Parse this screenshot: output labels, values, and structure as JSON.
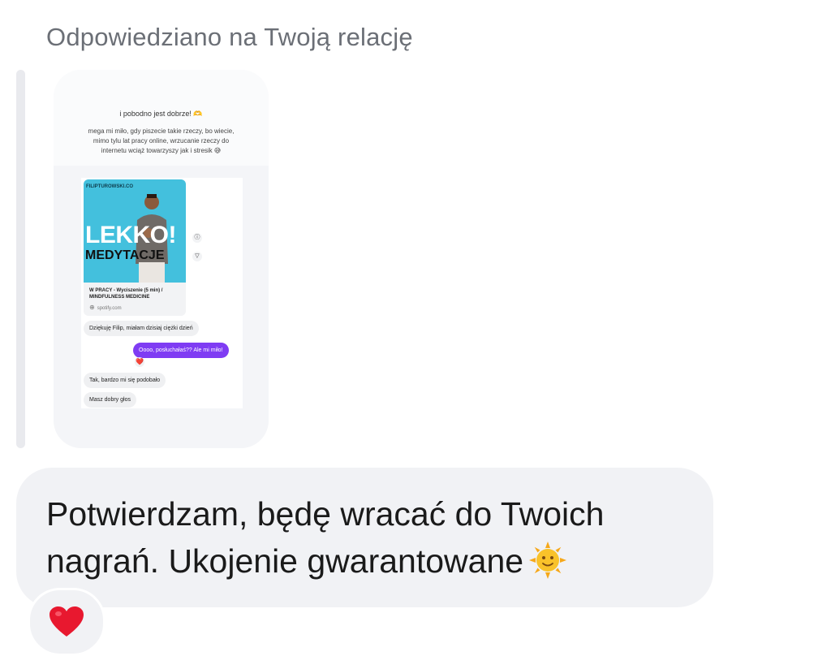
{
  "reply_header": "Odpowiedziano na Twoją relację",
  "story": {
    "heading": "i pobodno jest dobrze! 🫶",
    "body_lines": [
      "mega mi miło, gdy piszecie takie rzeczy, bo wiecie,",
      "mimo tylu lat pracy online, wrzucanie rzeczy do",
      "internetu wciąż towarzyszy jak i stresik 😅"
    ],
    "link_card": {
      "domain_badge": "FILIPTUROWSKI.CO",
      "thumb_title_1": "LEKKO!",
      "thumb_title_2": "MEDYTACJE",
      "title": "W PRACY - Wyciszenie (5 min) / MINDFULNESS MEDICINE",
      "source": "spotify.com"
    },
    "side_icons": [
      "ⓘ",
      "▽"
    ],
    "messages": [
      {
        "type": "received",
        "text": "Dziękuję Filip, miałam dzisiaj ciężki dzień"
      },
      {
        "type": "sent",
        "text": "Oooo, posłuchałaś?? Ale mi miło!"
      },
      {
        "type": "received",
        "text": "Tak, bardzo mi się podobało"
      },
      {
        "type": "received",
        "text": "Masz dobry głos"
      }
    ],
    "mini_reaction": "❤️"
  },
  "message": {
    "line1": "Potwierdzam, będę wracać do Twoich",
    "line2": "nagrań. Ukojenie gwarantowane"
  },
  "reaction": "heart",
  "colors": {
    "bubble_bg": "#f1f2f5",
    "sent_bubble": "#7f3cf3",
    "header_text": "#6b6f76",
    "heart": "#e8182f",
    "sun": "#f6b81e"
  }
}
